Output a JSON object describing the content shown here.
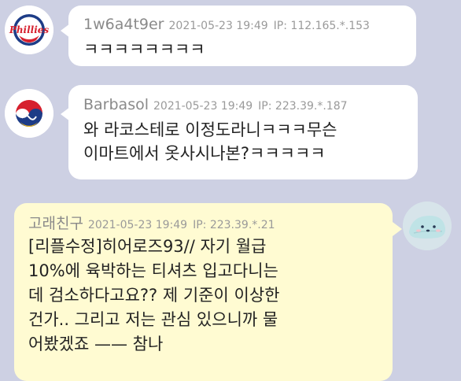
{
  "posts": [
    {
      "nickname": "1w6a4t9er",
      "time": "2021-05-23 19:49",
      "ip": "IP: 112.165.*.153",
      "lines": [
        "ㅋㅋㅋㅋㅋㅋㅋㅋ"
      ],
      "avatar_icon": "phillies-logo-icon"
    },
    {
      "nickname": "Barbasol",
      "time": "2021-05-23 19:49",
      "ip": "IP: 223.39.*.187",
      "lines": [
        "와 라코스테로 이정도라니ㅋㅋㅋ무슨",
        "이마트에서 옷사시나본?ㅋㅋㅋㅋㅋ"
      ],
      "avatar_icon": "kbo-emblem-icon"
    },
    {
      "nickname": "고래친구",
      "time": "2021-05-23 19:49",
      "ip": "IP: 223.39.*.21",
      "lines": [
        "[리플수정]히어로즈93// 자기 월급",
        "10%에 육박하는 티셔츠 입고다니는",
        "데 검소하다고요?? 제 기준이 이상한",
        "건가.. 그리고 저는 관심 있으니까 물",
        "어봤겠죠 —— 참나"
      ],
      "avatar_icon": "whale-icon"
    }
  ],
  "colors": {
    "background": "#cdd0e3",
    "bubble_other": "#ffffff",
    "bubble_mine": "#fffbd2",
    "phillies_red": "#d6202e",
    "phillies_blue": "#1d3c87"
  }
}
